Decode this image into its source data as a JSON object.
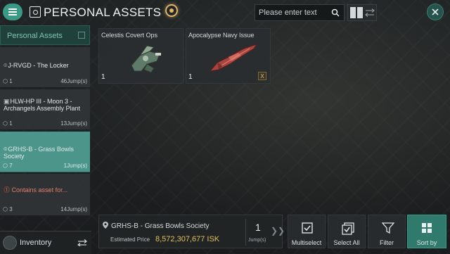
{
  "header": {
    "title": "PERSONAL ASSETS",
    "search_placeholder": "Please enter text"
  },
  "sidebar": {
    "heading": "Personal Assets",
    "locations": [
      {
        "name": "J-RVGD - The Locker",
        "count": "1",
        "jumps": "46Jump(s)",
        "active": false
      },
      {
        "name": "HLW-HP III - Moon 3 - Archangels Assembly Plant",
        "count": "1",
        "jumps": "13Jump(s)",
        "active": false
      },
      {
        "name": "GRHS-B - Grass Bowls Society",
        "count": "7",
        "jumps": "1Jump(s)",
        "active": true
      },
      {
        "name": "Contains asset for...",
        "count": "3",
        "jumps": "14Jump(s)",
        "active": false,
        "warning": true
      }
    ],
    "inventory_label": "Inventory"
  },
  "assets": [
    {
      "name": "Celestis Covert Ops",
      "qty": "1"
    },
    {
      "name": "Apocalypse Navy Issue",
      "qty": "1",
      "badge": "X"
    }
  ],
  "footer": {
    "system": "GRHS-B - Grass Bowls Society",
    "estimated_price_label": "Estimated Price",
    "estimated_price": "8,572,307,677 ISK",
    "jumps_value": "1",
    "jumps_label": "Jump(s)",
    "actions": {
      "multiselect": "Multiselect",
      "select_all": "Select All",
      "filter": "Filter",
      "sort_by": "Sort by"
    }
  },
  "colors": {
    "accent": "#3b9a86",
    "active_location": "#4b958a",
    "price": "#e3bf5c",
    "warning": "#e0563f"
  }
}
